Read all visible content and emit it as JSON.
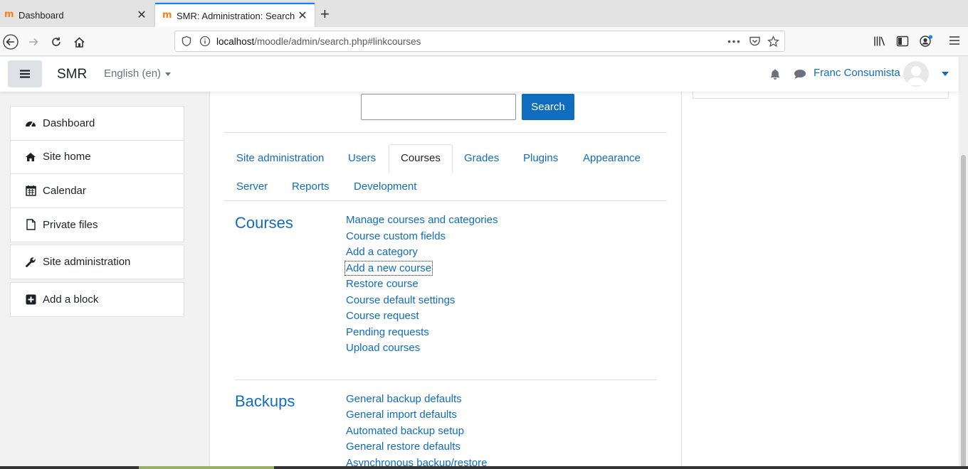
{
  "browser": {
    "tabs": [
      {
        "title": "Dashboard",
        "favicon": "moodle-icon",
        "active": false
      },
      {
        "title": "SMR: Administration: Search",
        "favicon": "moodle-icon",
        "active": true
      }
    ],
    "new_tab": "+",
    "url_host": "localhost",
    "url_path": "/moodle/admin/search.php#linkcourses"
  },
  "header": {
    "brand": "SMR",
    "language": "English (en)",
    "user_name": "Franc Consumista"
  },
  "drawer": {
    "group1": [
      {
        "label": "Dashboard",
        "icon": "dashboard-icon"
      },
      {
        "label": "Site home",
        "icon": "home-icon"
      },
      {
        "label": "Calendar",
        "icon": "calendar-icon"
      },
      {
        "label": "Private files",
        "icon": "file-icon"
      }
    ],
    "site_admin": {
      "label": "Site administration",
      "icon": "wrench-icon"
    },
    "add_block": {
      "label": "Add a block",
      "icon": "plus-square-icon"
    }
  },
  "search": {
    "value": "",
    "button": "Search"
  },
  "tabs": [
    "Site administration",
    "Users",
    "Courses",
    "Grades",
    "Plugins",
    "Appearance",
    "Server",
    "Reports",
    "Development"
  ],
  "active_tab": "Courses",
  "sections": [
    {
      "title": "Courses",
      "links": [
        "Manage courses and categories",
        "Course custom fields",
        "Add a category",
        "Add a new course",
        "Restore course",
        "Course default settings",
        "Course request",
        "Pending requests",
        "Upload courses"
      ]
    },
    {
      "title": "Backups",
      "links": [
        "General backup defaults",
        "General import defaults",
        "Automated backup setup",
        "General restore defaults",
        "Asynchronous backup/restore"
      ]
    }
  ],
  "colors": {
    "link": "#0f6cbf",
    "primary_button": "#0f6cbf",
    "text": "#1d2125",
    "tab_accent": "#0a84ff",
    "moodle_orange": "#f98012"
  }
}
